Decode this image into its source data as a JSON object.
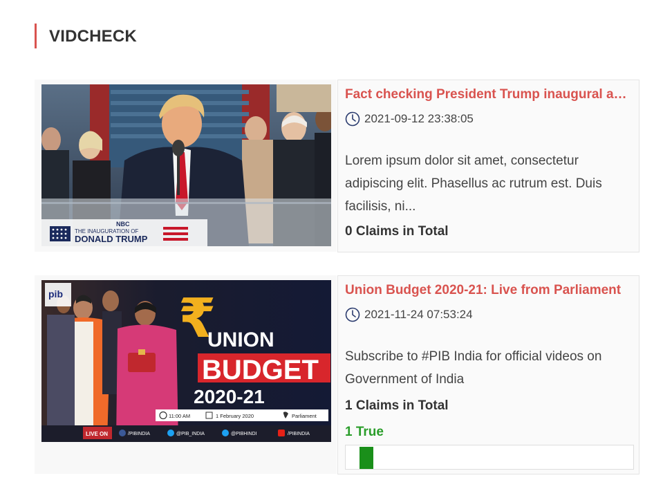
{
  "section": {
    "title": "VIDCHECK"
  },
  "cards": [
    {
      "title": "Fact checking President Trump inaugural address",
      "date": "2021-09-12 23:38:05",
      "description": "Lorem ipsum dolor sit amet, consectetur adipiscing elit. Phasellus ac rutrum est. Duis facilisis, ni...",
      "claims": "0 Claims in Total",
      "thumbnail": {
        "network": "NBC",
        "banner_line1": "THE INAUGURATION OF",
        "banner_line2": "DONALD TRUMP"
      }
    },
    {
      "title": "Union Budget 2020-21: Live from Parliament",
      "date": "2021-11-24 07:53:24",
      "description": "Subscribe to #PIB India for official videos on Government of India",
      "claims": "1 Claims in Total",
      "true_label": "1 True",
      "true_fraction": 0.048,
      "thumbnail": {
        "logo": "pib",
        "rupee": "₹",
        "word1": "UNION",
        "word2": "BUDGET",
        "year": "2020-21",
        "time": "11:00 AM",
        "date": "1 February 2020",
        "place": "Parliament",
        "live_on": "LIVE ON",
        "handles": [
          "/PIBINDIA",
          "@PIB_INDIA",
          "@PIBHINDI",
          "/PIBINDIA"
        ]
      }
    }
  ],
  "colors": {
    "accent": "#d9534f",
    "true_green": "#1a8f1a",
    "budget_red": "#d8262c",
    "budget_gold": "#f2b01e",
    "navy": "#1b2a5c"
  }
}
